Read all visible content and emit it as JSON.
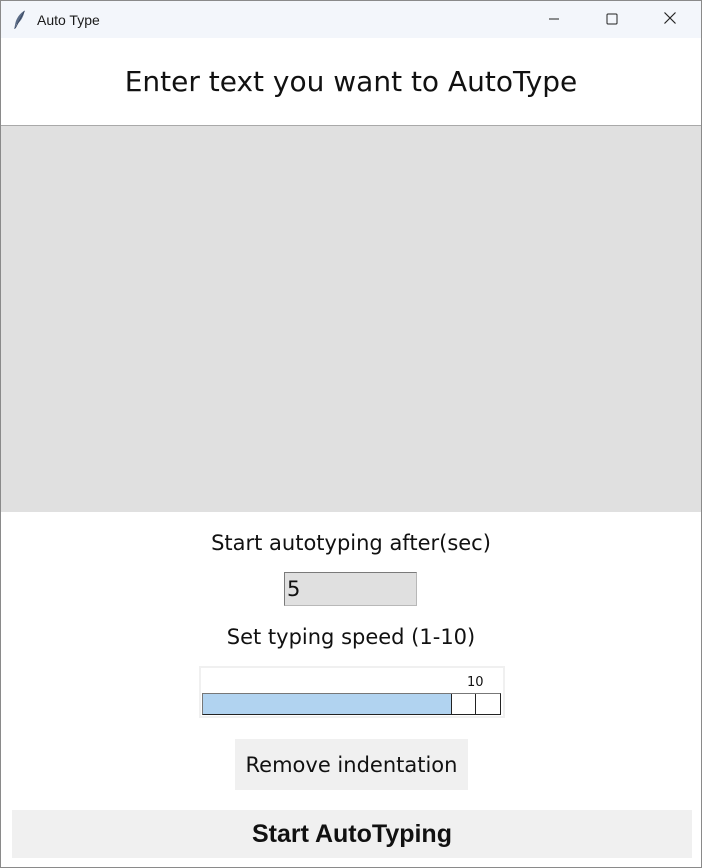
{
  "window": {
    "title": "Auto Type",
    "icons": [
      "feather-icon",
      "minimize-icon",
      "maximize-icon",
      "close-icon"
    ]
  },
  "heading": "Enter text you want to AutoType",
  "text_area": {
    "value": ""
  },
  "delay": {
    "label": "Start autotyping after(sec)",
    "value": "5"
  },
  "speed": {
    "label": "Set typing speed (1-10)",
    "value": "10",
    "min": 1,
    "max": 10,
    "level_fraction": 1.0
  },
  "buttons": {
    "remove_indentation": "Remove indentation",
    "start": "Start AutoTyping"
  },
  "colors": {
    "text_area_bg": "#e0e0e0",
    "trough_fill": "#b1d3f0",
    "button_bg": "#f0f0f0",
    "titlebar_bg": "#f3f6fb"
  }
}
